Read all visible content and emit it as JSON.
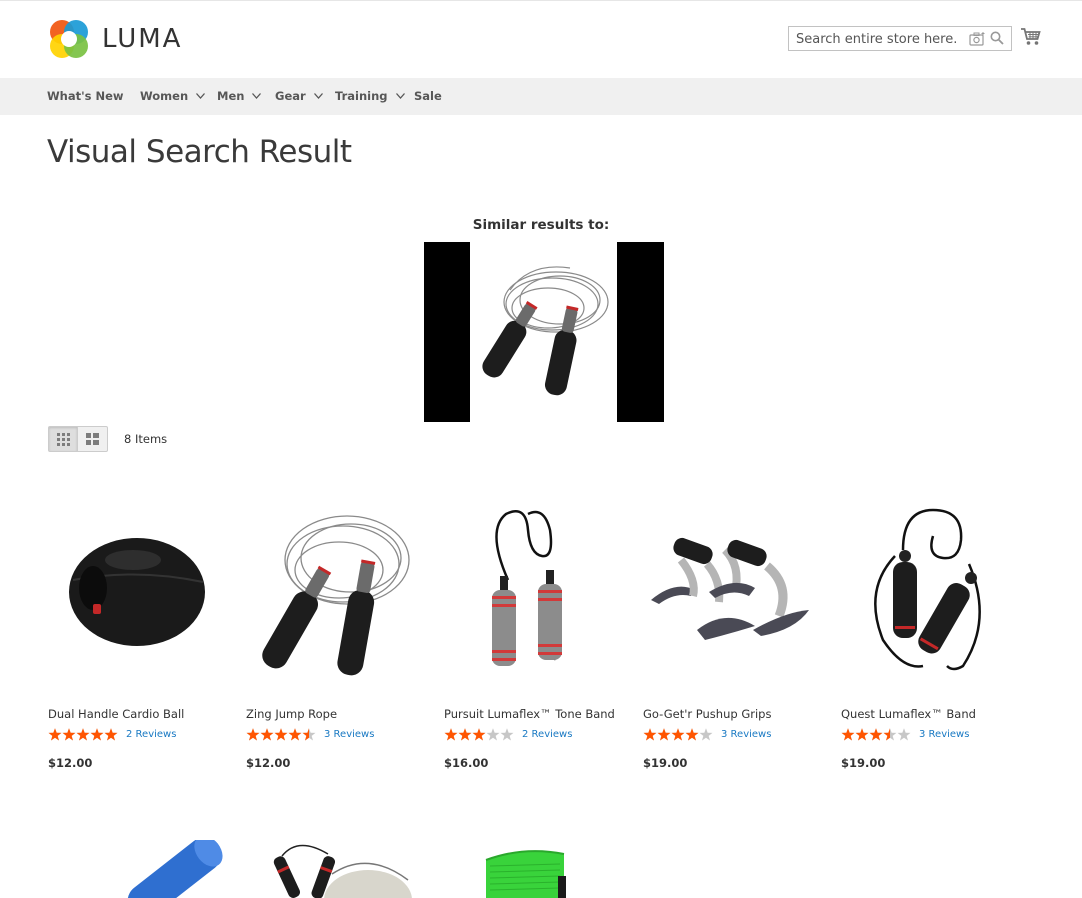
{
  "header": {
    "logo_text": "LUMA",
    "search_placeholder": "Search entire store here..."
  },
  "nav": {
    "items": [
      {
        "label": "What's New",
        "has_dropdown": false
      },
      {
        "label": "Women",
        "has_dropdown": true
      },
      {
        "label": "Men",
        "has_dropdown": true
      },
      {
        "label": "Gear",
        "has_dropdown": true
      },
      {
        "label": "Training",
        "has_dropdown": true
      },
      {
        "label": "Sale",
        "has_dropdown": false
      }
    ]
  },
  "page_title": "Visual Search Result",
  "similar_label": "Similar results to:",
  "toolbar": {
    "items_count": "8 Items",
    "view_mode": "grid"
  },
  "products": [
    {
      "name": "Dual Handle Cardio Ball",
      "rating": 5,
      "reviews": "2  Reviews",
      "price": "$12.00"
    },
    {
      "name": "Zing Jump Rope",
      "rating": 4.5,
      "reviews": "3  Reviews",
      "price": "$12.00"
    },
    {
      "name": "Pursuit Lumaflex™ Tone Band",
      "rating": 3,
      "reviews": "2  Reviews",
      "price": "$16.00"
    },
    {
      "name": "Go-Get'r Pushup Grips",
      "rating": 4,
      "reviews": "3  Reviews",
      "price": "$19.00"
    },
    {
      "name": "Quest Lumaflex™ Band",
      "rating": 3.5,
      "reviews": "3  Reviews",
      "price": "$19.00"
    }
  ],
  "colors": {
    "accent": "#1979c3",
    "star_filled": "#ff5501",
    "star_empty": "#c7c7c7",
    "nav_bg": "#f0f0f0"
  }
}
